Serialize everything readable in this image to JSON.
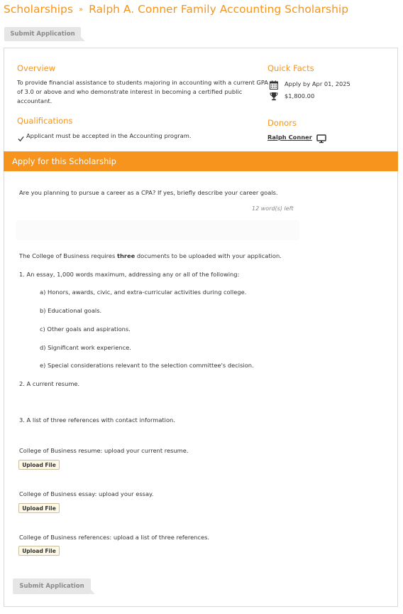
{
  "breadcrumb": {
    "parent": "Scholarships",
    "separator": "»",
    "current": "Ralph A. Conner Family Accounting Scholarship"
  },
  "actions": {
    "submit_label_top": "Submit Application",
    "submit_label_bottom": "Submit Application"
  },
  "overview": {
    "heading": "Overview",
    "line1": "To provide financial assistance to students majoring in accounting with a current GPA",
    "line2": "of 3.0 or above and who demonstrate interest in becoming a certified public",
    "line3": "accountant."
  },
  "qualifications": {
    "heading": "Qualifications",
    "item1": "Applicant must be accepted in the Accounting program."
  },
  "quick_facts": {
    "heading": "Quick Facts",
    "deadline": "Apply by Apr 01, 2025",
    "amount": "$1,800.00"
  },
  "donors": {
    "heading": "Donors",
    "name": "Ralph Conner"
  },
  "apply": {
    "heading": "Apply for this Scholarship",
    "question": "Are you planning to pursue a career as a CPA? If yes, briefly describe your career goals.",
    "words_left": "12 word(s) left",
    "docs_intro_pre": "The College of Business requires ",
    "docs_intro_bold": "three",
    "docs_intro_post": " documents to be uploaded with your application.",
    "item1": "1. An essay, 1,000 words maximum, addressing any or all of the following:",
    "sub_a": "a) Honors, awards, civic, and extra-curricular activities during college.",
    "sub_b": "b) Educational goals.",
    "sub_c": "c) Other goals and aspirations.",
    "sub_d": "d) Significant work experience.",
    "sub_e": "e) Special considerations relevant to the selection committee's decision.",
    "item2": "2. A current resume.",
    "item3": "3. A list of three references with contact information.",
    "upload_resume_label": "College of Business resume: upload your current resume.",
    "upload_essay_label": "College of Business essay: upload your essay.",
    "upload_refs_label": "College of Business references: upload a list of three references.",
    "upload_button": "Upload File"
  },
  "colors": {
    "accent": "#f7941d",
    "upload_bg": "#fdf9e6",
    "disabled_button": "#e6e6e6"
  }
}
